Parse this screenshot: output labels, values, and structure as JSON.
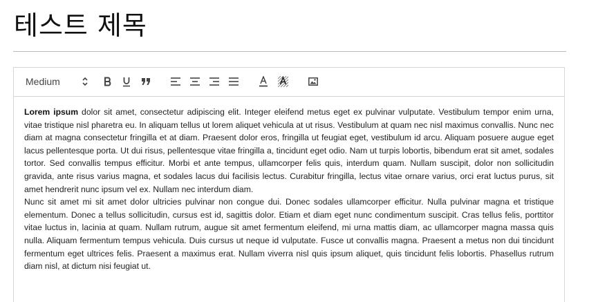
{
  "page": {
    "title": "테스트 제목"
  },
  "toolbar": {
    "size_value": "Medium",
    "buttons": [
      {
        "name": "bold-button",
        "icon": "bold-icon"
      },
      {
        "name": "underline-button",
        "icon": "underline-icon"
      },
      {
        "name": "blockquote-button",
        "icon": "quote-icon"
      },
      {
        "name": "align-left-button",
        "icon": "align-left-icon"
      },
      {
        "name": "align-center-button",
        "icon": "align-center-icon"
      },
      {
        "name": "align-right-button",
        "icon": "align-right-icon"
      },
      {
        "name": "align-justify-button",
        "icon": "align-justify-icon"
      },
      {
        "name": "text-color-button",
        "icon": "text-color-icon"
      },
      {
        "name": "background-color-button",
        "icon": "background-color-icon"
      },
      {
        "name": "insert-image-button",
        "icon": "image-icon"
      }
    ]
  },
  "content": {
    "paragraph1_bold": "Lorem ipsum",
    "paragraph1_rest": " dolor sit amet, consectetur adipiscing elit. Integer eleifend metus eget ex pulvinar vulputate. Vestibulum tempor enim urna, vitae tristique nisl pharetra eu. In aliquam tellus ut lorem aliquet vehicula at ut risus. Vestibulum at quam nec nisl maximus convallis. Nunc nec diam at magna consectetur fringilla et at diam. Praesent dolor eros, fringilla ut feugiat eget, vestibulum id arcu. Aliquam posuere augue eget lacus pellentesque porta. Ut dui risus, pellentesque vitae fringilla a, tincidunt eget odio. Nam ut turpis lobortis, bibendum erat sit amet, sodales tortor. Sed convallis tempus efficitur. Morbi et ante tempus, ullamcorper felis quis, interdum quam. Nullam suscipit, dolor non sollicitudin gravida, ante risus varius magna, et sodales lacus dui facilisis lectus. Curabitur fringilla, lectus vitae ornare varius, orci erat luctus purus, sit amet hendrerit nunc ipsum vel ex. Nullam nec interdum diam.",
    "paragraph2": "Nunc sit amet mi sit amet dolor ultricies pulvinar non congue dui. Donec sodales ullamcorper efficitur. Nulla pulvinar magna et tristique elementum. Donec a tellus sollicitudin, cursus est id, sagittis dolor. Etiam et diam eget nunc condimentum suscipit. Cras tellus felis, porttitor vitae luctus in, lacinia at quam. Nullam rutrum, augue sit amet fermentum eleifend, mi urna mattis diam, ac ullamcorper magna massa quis nulla. Aliquam fermentum tempus vehicula. Duis cursus ut neque id vulputate. Fusce ut convallis magna. Praesent a metus non dui tincidunt fermentum eget ultrices felis. Praesent a maximus erat. Nullam viverra nisl quis ipsum aliquet, quis tincidunt felis lobortis. Phasellus rutrum diam nisl, at dictum nisi feugiat ut."
  }
}
